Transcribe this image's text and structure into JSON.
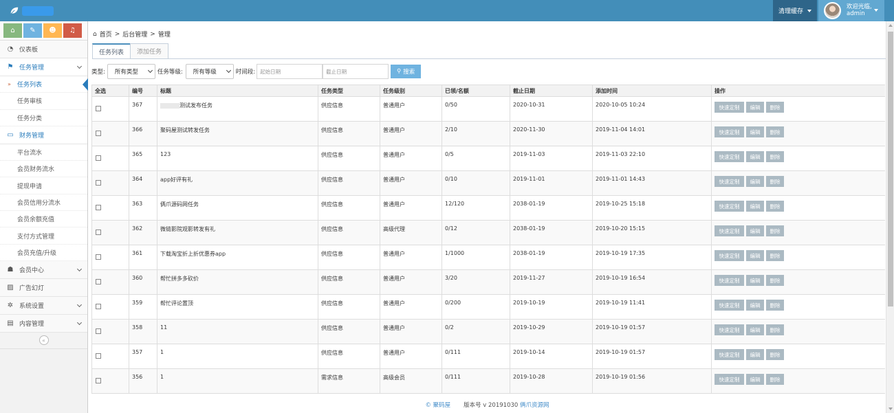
{
  "header": {
    "cache_label": "清理缓存",
    "welcome": "欢迎光临,",
    "username": "admin"
  },
  "sidebar": {
    "items": [
      {
        "label": "仪表板",
        "icon": "dashboard-icon"
      },
      {
        "label": "任务管理",
        "icon": "flag-icon",
        "open": true,
        "children": [
          "任务列表",
          "任务审核",
          "任务分类"
        ]
      },
      {
        "label": "财务管理",
        "icon": "inbox-icon",
        "open": true,
        "children": [
          "平台流水",
          "会员财务流水",
          "提现申请",
          "会员信用分流水",
          "会员余额充值",
          "支付方式管理",
          "会员充值/升级"
        ]
      },
      {
        "label": "会员中心",
        "icon": "user-icon"
      },
      {
        "label": "广告幻灯",
        "icon": "picture-icon"
      },
      {
        "label": "系统设置",
        "icon": "gear-icon"
      },
      {
        "label": "内容管理",
        "icon": "book-icon"
      }
    ]
  },
  "breadcrumb": {
    "home": "首页",
    "sep": ">",
    "level1": "后台管理",
    "level2": "管理"
  },
  "tabs": {
    "list": "任务列表",
    "add": "添加任务"
  },
  "filter": {
    "type_label": "类型:",
    "type_value": "所有类型",
    "level_label": "任务等级:",
    "level_value": "所有等级",
    "time_label": "时间段:",
    "start_placeholder": "起始日期",
    "end_placeholder": "截止日期",
    "search_label": "搜索"
  },
  "table": {
    "headers": [
      "全选",
      "编号",
      "标题",
      "任务类型",
      "任务级别",
      "已领/名额",
      "截止日期",
      "添加时间",
      "操作"
    ],
    "ops": {
      "quick": "快速定制",
      "edit": "编辑",
      "delete": "删除"
    },
    "rows": [
      {
        "id": "367",
        "title": "测试发布任务",
        "type": "供应信息",
        "level": "普通用户",
        "quota": "0/50",
        "deadline": "2020-10-31",
        "added": "2020-10-05 10:24"
      },
      {
        "id": "366",
        "title": "聚码屋测试转发任务",
        "type": "供应信息",
        "level": "普通用户",
        "quota": "2/10",
        "deadline": "2020-11-30",
        "added": "2019-11-04 14:01"
      },
      {
        "id": "365",
        "title": "123",
        "type": "供应信息",
        "level": "普通用户",
        "quota": "0/5",
        "deadline": "2019-11-03",
        "added": "2019-11-03 22:10"
      },
      {
        "id": "364",
        "title": "app好评有礼",
        "type": "供应信息",
        "level": "普通用户",
        "quota": "0/10",
        "deadline": "2019-11-01",
        "added": "2019-11-01 14:43"
      },
      {
        "id": "363",
        "title": "俩爪源码网任务",
        "type": "供应信息",
        "level": "普通用户",
        "quota": "12/120",
        "deadline": "2038-01-19",
        "added": "2019-10-25 15:18"
      },
      {
        "id": "362",
        "title": "微链影院观影转发有礼",
        "type": "供应信息",
        "level": "高级代理",
        "quota": "0/12",
        "deadline": "2038-01-19",
        "added": "2019-10-20 15:15"
      },
      {
        "id": "361",
        "title": "下载淘宝折上折优惠券app",
        "type": "供应信息",
        "level": "普通用户",
        "quota": "1/1000",
        "deadline": "2038-01-19",
        "added": "2019-10-19 17:35"
      },
      {
        "id": "360",
        "title": "帮忙拼多多砍价",
        "type": "供应信息",
        "level": "普通用户",
        "quota": "3/20",
        "deadline": "2019-11-27",
        "added": "2019-10-19 16:54"
      },
      {
        "id": "359",
        "title": "帮忙评论置顶",
        "type": "供应信息",
        "level": "普通用户",
        "quota": "0/200",
        "deadline": "2019-10-19",
        "added": "2019-10-19 11:41"
      },
      {
        "id": "358",
        "title": "11",
        "type": "供应信息",
        "level": "普通用户",
        "quota": "0/2",
        "deadline": "2019-10-29",
        "added": "2019-10-19 01:57"
      },
      {
        "id": "357",
        "title": "1",
        "type": "供应信息",
        "level": "普通用户",
        "quota": "0/111",
        "deadline": "2019-10-14",
        "added": "2019-10-19 01:57"
      },
      {
        "id": "356",
        "title": "1",
        "type": "需求信息",
        "level": "高级会员",
        "quota": "0/111",
        "deadline": "2019-10-28",
        "added": "2019-10-19 01:56"
      }
    ]
  },
  "footer": {
    "copyright": "© 聚码屋",
    "version_label": "版本号 v 20191030",
    "site": "俩爪资源网"
  }
}
